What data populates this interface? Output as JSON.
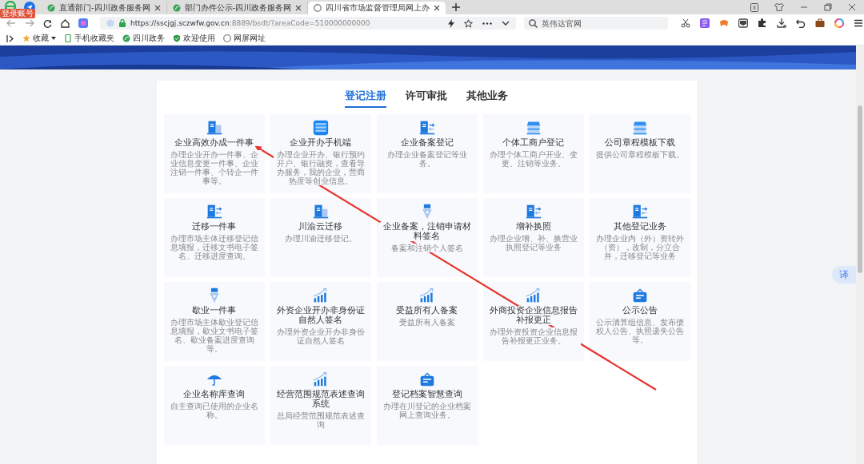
{
  "browser": {
    "badge": "登录账号",
    "tabs": [
      {
        "title": "直通部门-四川政务服务网",
        "selected": false
      },
      {
        "title": "部门办件公示-四川政务服务网",
        "selected": false
      },
      {
        "title": "四川省市场监督管理局网上办",
        "selected": true
      }
    ],
    "url_host": "https://sscjgj.sczwfw.gov.cn",
    "url_rest": ":8889/bsdt/?areaCode=510000000000",
    "search": {
      "placeholder": "英伟达官网"
    },
    "bookmarks": [
      {
        "label": "收藏",
        "kind": "star"
      },
      {
        "label": "手机收藏夹",
        "kind": "phone"
      },
      {
        "label": "四川政务",
        "kind": "leaf"
      },
      {
        "label": "欢迎使用",
        "kind": "shield"
      },
      {
        "label": "网屏网址",
        "kind": "globe"
      }
    ]
  },
  "page": {
    "tabs": [
      {
        "label": "登记注册",
        "selected": true
      },
      {
        "label": "许可审批",
        "selected": false
      },
      {
        "label": "其他业务",
        "selected": false
      }
    ],
    "cards": [
      {
        "kind": "building",
        "title": "企业高效办成一件事",
        "desc": "办理企业开办一件事、企业信息变更一件事、企业注销一件事、个转企一件事等。"
      },
      {
        "kind": "app",
        "title": "企业开办手机端",
        "desc": "办理企业开办、银行预约开户、银行融资，查看导办服务，我的企业，营商热度等创业信息。"
      },
      {
        "kind": "transfer",
        "title": "企业备案登记",
        "desc": "办理企业备案登记等业务。"
      },
      {
        "kind": "shop",
        "title": "个体工商户登记",
        "desc": "办理个体工商户开业、变更、注销等业务。"
      },
      {
        "kind": "shop",
        "title": "公司章程模板下载",
        "desc": "提供公司章程模板下载。"
      },
      {
        "kind": "transfer",
        "title": "迁移一件事",
        "desc": "办理市场主体迁移登记信息填报，迁移文书电子签名、迁移进度查询。"
      },
      {
        "kind": "building",
        "title": "川渝云迁移",
        "desc": "办理川渝迁移登记。"
      },
      {
        "kind": "pen",
        "title": "企业备案，注销申请材料签名",
        "desc": "备案和注销个人签名"
      },
      {
        "kind": "transfer",
        "title": "增补换照",
        "desc": "办理企业增、补、换营业执照登记等业务"
      },
      {
        "kind": "transfer",
        "title": "其他登记业务",
        "desc": "办理企业内（外）资转外（资），改制，分立合并，迁移登记等业务"
      },
      {
        "kind": "pen",
        "title": "歇业一件事",
        "desc": "办理市场主体歇业登记信息填报，歇业文书电子签名、歇业备案进度查询等。"
      },
      {
        "kind": "chart",
        "title": "外资企业开办非身份证自然人签名",
        "desc": "办理外资企业开办非身份证自然人签名"
      },
      {
        "kind": "chart",
        "title": "受益所有人备案",
        "desc": "受益所有人备案"
      },
      {
        "kind": "chart",
        "title": "外商投资企业信息报告补报更正",
        "desc": "办理外资投资企业信息报告补报更正业务。"
      },
      {
        "kind": "board",
        "title": "公示公告",
        "desc": "公示清算组信息、发布债权人公告、执照遗失公告等。"
      },
      {
        "kind": "umbrella",
        "title": "企业名称库查询",
        "desc": "自主查询已使用的企业名称。"
      },
      {
        "kind": "chart",
        "title": "经营范围规范表述查询系统",
        "desc": "总局经营范围规范表述查询"
      },
      {
        "kind": "board",
        "title": "登记档案智慧查询",
        "desc": "办理在川登记的企业档案网上查询业务。"
      }
    ],
    "translate": "译"
  }
}
